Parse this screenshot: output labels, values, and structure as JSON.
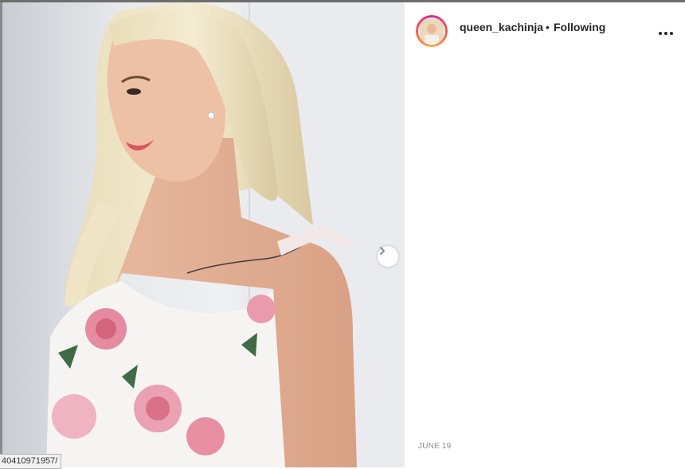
{
  "post": {
    "username": "queen_kachinja",
    "separator": "•",
    "follow_status": "Following",
    "date": "JUNE 19",
    "photo_alt": "photo"
  },
  "browser": {
    "url_fragment": "40410971957/"
  },
  "icons": {
    "more": "more-options-icon",
    "next": "chevron-right-icon"
  },
  "colors": {
    "text": "#262626",
    "muted": "#8e8e8e",
    "story_ring_start": "#d6249f",
    "story_ring_end": "#fdaa3f"
  }
}
